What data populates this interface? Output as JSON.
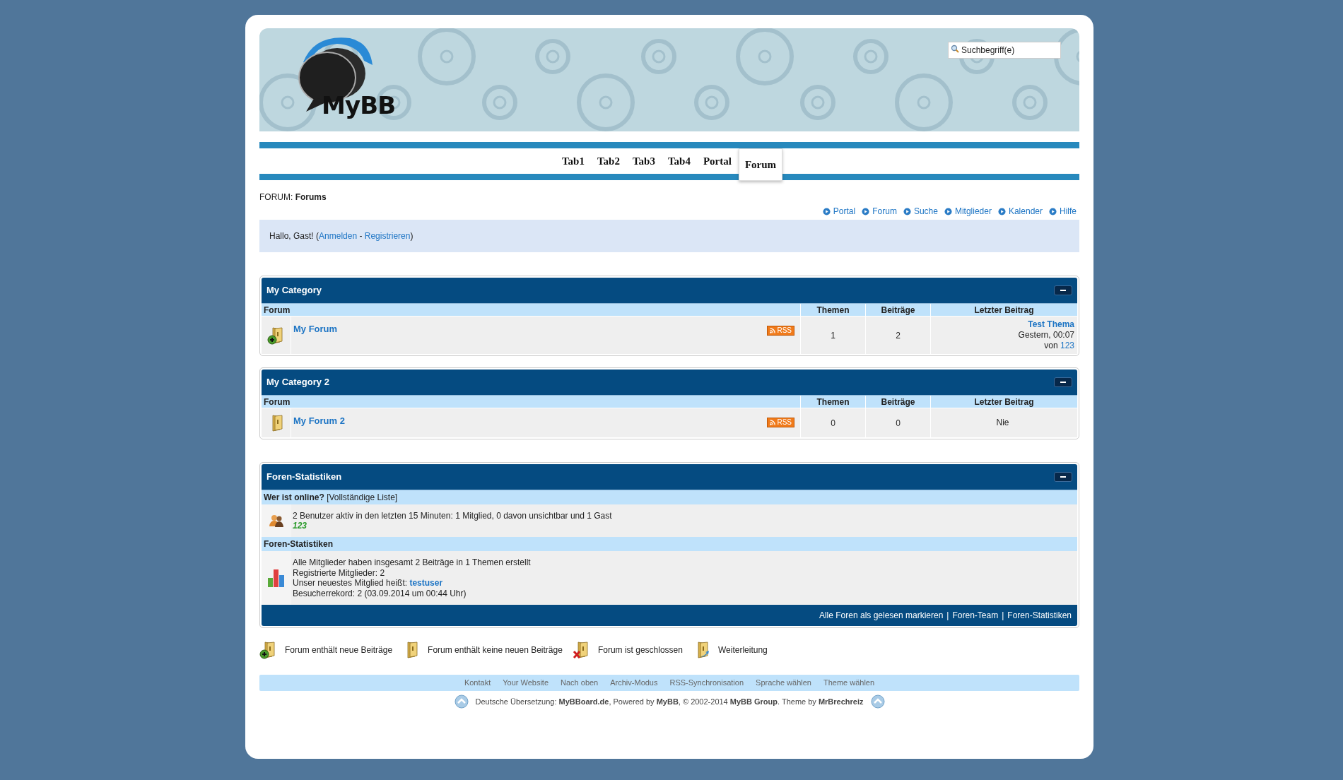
{
  "search": {
    "placeholder": "Suchbegriff(e)"
  },
  "logo": {
    "text": "MyBB"
  },
  "tabs": [
    {
      "label": "Tab1",
      "selected": false
    },
    {
      "label": "Tab2",
      "selected": false
    },
    {
      "label": "Tab3",
      "selected": false
    },
    {
      "label": "Tab4",
      "selected": false
    },
    {
      "label": "Portal",
      "selected": false
    },
    {
      "label": "Forum",
      "selected": true
    }
  ],
  "breadcrumb": {
    "prefix": "FORUM:",
    "current": "Forums"
  },
  "nav_links": [
    "Portal",
    "Forum",
    "Suche",
    "Mitglieder",
    "Kalender",
    "Hilfe"
  ],
  "welcome": {
    "greeting": "Hallo, Gast! (",
    "links": [
      "Anmelden",
      "Registrieren"
    ],
    "separator": "-",
    "closing": ")"
  },
  "categories": [
    {
      "title": "My Category",
      "columns": [
        "Forum",
        "Themen",
        "Beiträge",
        "Letzter Beitrag"
      ],
      "forums": [
        {
          "kind": "new",
          "name": "My Forum",
          "rss": "RSS",
          "topics": "1",
          "posts": "2",
          "last_post": {
            "kind": "post",
            "title": "Test Thema",
            "date": "Gestern, 00:07",
            "by": "von",
            "author": "123"
          }
        }
      ]
    },
    {
      "title": "My Category 2",
      "columns": [
        "Forum",
        "Themen",
        "Beiträge",
        "Letzter Beitrag"
      ],
      "forums": [
        {
          "kind": "old",
          "name": "My Forum 2",
          "rss": "RSS",
          "topics": "0",
          "posts": "0",
          "last_post": {
            "kind": "none",
            "text": "Nie"
          }
        }
      ]
    }
  ],
  "stats": {
    "title": "Foren-Statistiken",
    "online": {
      "heading": "**Wer ist online?** [Vollständige Liste]",
      "summary": "2 Benutzer aktiv in den letzten 15 Minuten: 1 Mitglied, 0 davon unsichtbar und 1 Gast",
      "members": [
        "123"
      ]
    },
    "statistics": {
      "heading": "Foren-Statistiken",
      "lines": [
        "Alle Mitglieder haben insgesamt 2 Beiträge in 1 Themen erstellt",
        "Registrierte Mitglieder: 2"
      ],
      "newest": {
        "prefix": "Unser neuestes Mitglied heißt:",
        "name": "testuser"
      },
      "record": "Besucherrekord: 2 (03.09.2014 um 00:44 Uhr)"
    },
    "links": [
      "Alle Foren als gelesen markieren",
      "Foren-Team",
      "Foren-Statistiken"
    ],
    "separator": "|"
  },
  "legend": [
    {
      "kind": "new",
      "label": "Forum enthält neue Beiträge"
    },
    {
      "kind": "old",
      "label": "Forum enthält keine neuen Beiträge"
    },
    {
      "kind": "closed",
      "label": "Forum ist geschlossen"
    },
    {
      "kind": "redirect",
      "label": "Weiterleitung"
    }
  ],
  "footer": {
    "links": [
      "Kontakt",
      "Your Website",
      "Nach oben",
      "Archiv-Modus",
      "RSS-Synchronisation",
      "Sprache wählen",
      "Theme wählen"
    ],
    "copyright": "Deutsche Übersetzung: **MyBBoard.de**, Powered by **MyBB**, © 2002-2014 **MyBB Group**. Theme by **MrBrechreiz**"
  }
}
